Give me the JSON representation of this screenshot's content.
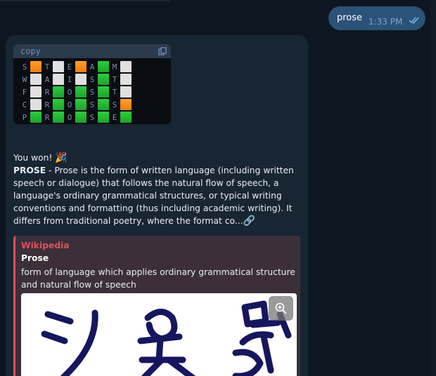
{
  "outgoing": {
    "text": "prose",
    "time": "1:33 PM"
  },
  "code": {
    "language": "copy",
    "rows": [
      {
        "letters": [
          "S",
          "T",
          "E",
          "A",
          "M"
        ],
        "marks": [
          "o",
          "w",
          "o",
          "g",
          "w"
        ]
      },
      {
        "letters": [
          "W",
          "A",
          "I",
          "S",
          "T"
        ],
        "marks": [
          "w",
          "w",
          "w",
          "g",
          "w"
        ]
      },
      {
        "letters": [
          "F",
          "R",
          "O",
          "S",
          "T"
        ],
        "marks": [
          "w",
          "g",
          "g",
          "g",
          "w"
        ]
      },
      {
        "letters": [
          "C",
          "R",
          "O",
          "S",
          "S"
        ],
        "marks": [
          "w",
          "g",
          "g",
          "g",
          "o"
        ]
      },
      {
        "letters": [
          "P",
          "R",
          "O",
          "S",
          "E"
        ],
        "marks": [
          "g",
          "g",
          "g",
          "g",
          "g"
        ]
      }
    ]
  },
  "message": {
    "won": "You won!",
    "won_emoji": "🎉",
    "word": "PROSE",
    "definition": " - Prose is the form of written language (including written speech or dialogue) that follows the natural flow of speech, a language's ordinary grammatical structures, or typical writing conventions and formatting (thus including academic writing). It differs from traditional poetry, where the format co...",
    "link_emoji": "🔗"
  },
  "preview": {
    "site": "Wikipedia",
    "title": "Prose",
    "description": "form of language which applies ordinary grammatical structure and natural flow of speech"
  },
  "colors": {
    "background": "#0e1621",
    "outgoing_bubble": "#2b5278",
    "incoming_bubble": "#182533",
    "accent_red": "#e0525a",
    "green": "#2ecc40",
    "orange": "#ff9f2a"
  },
  "icons": [
    "double-check-icon",
    "copy-icon",
    "zoom-in-icon"
  ]
}
